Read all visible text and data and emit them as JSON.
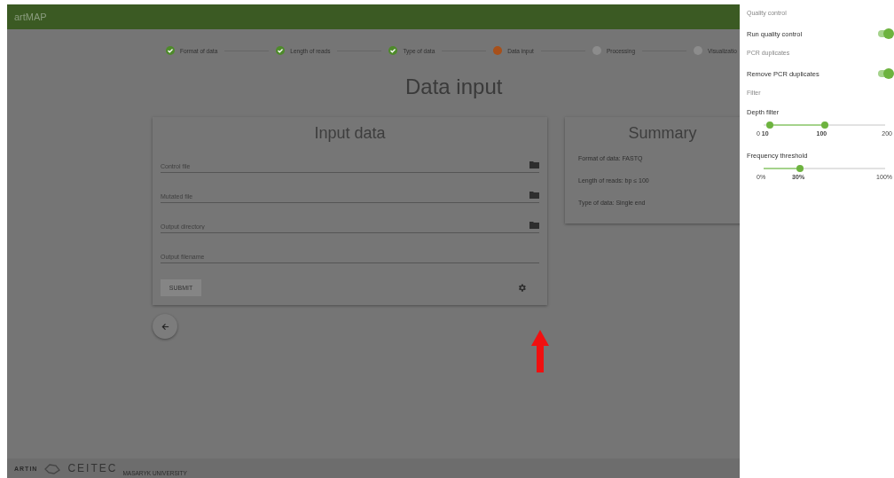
{
  "app": {
    "title": "artMAP"
  },
  "steps": [
    {
      "label": "Format of data",
      "kind": "done"
    },
    {
      "label": "Length of reads",
      "kind": "done"
    },
    {
      "label": "Type of data",
      "kind": "done"
    },
    {
      "label": "Data input",
      "kind": "active"
    },
    {
      "label": "Processing",
      "kind": "pending"
    },
    {
      "label": "Visualizatio",
      "kind": "pending"
    }
  ],
  "page_title": "Data input",
  "input_card": {
    "title": "Input data",
    "fields": [
      {
        "placeholder": "Control file",
        "kind": "file"
      },
      {
        "placeholder": "Mutated file",
        "kind": "file"
      },
      {
        "placeholder": "Output directory",
        "kind": "file"
      },
      {
        "placeholder": "Output filename",
        "kind": "text"
      }
    ],
    "submit": {
      "label": "SUBMIT",
      "disabled": true
    }
  },
  "summary_card": {
    "title": "Summary",
    "lines": [
      "Format of data: FASTQ",
      "Length of reads: bp ≤ 100",
      "Type of data: Single end"
    ]
  },
  "footer": {
    "logos": [
      "ARTIN",
      "CEITEC"
    ],
    "subtitle": "MASARYK UNIVERSITY"
  },
  "drawer": {
    "sections": [
      {
        "heading": "Quality control",
        "kind": "switch",
        "label": "Run quality control",
        "on": true
      },
      {
        "heading": "PCR duplicates",
        "kind": "switch",
        "label": "Remove PCR duplicates",
        "on": true
      },
      {
        "heading": "Filter",
        "kind": "heading"
      },
      {
        "kind": "range",
        "label": "Depth filter",
        "thumbs": [
          {
            "level": 0.05
          },
          {
            "level": 0.5
          }
        ],
        "ticks": [
          "0",
          "10",
          "100",
          "200"
        ]
      },
      {
        "kind": "slider",
        "label": "Frequency threshold",
        "level": 0.3,
        "ticks": [
          "0%",
          "30%",
          "100%"
        ]
      }
    ]
  }
}
